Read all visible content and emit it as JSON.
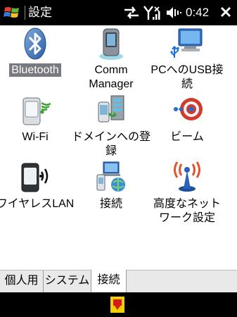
{
  "titlebar": {
    "title": "設定",
    "time": "0:42"
  },
  "icons": {
    "start": "windows-flag-icon",
    "connectivity": "connectivity-arrows-icon",
    "signal": "signal-strength-icon",
    "volume": "speaker-muted-icon",
    "close": "close-icon"
  },
  "items": [
    {
      "label": "Bluetooth",
      "icon": "bluetooth-icon",
      "selected": true
    },
    {
      "label1": "Comm",
      "label2": "Manager",
      "icon": "comm-manager-icon"
    },
    {
      "label1": "PCへのUSB接",
      "label2": "続",
      "icon": "usb-to-pc-icon"
    },
    {
      "label": "Wi-Fi",
      "icon": "wifi-icon"
    },
    {
      "label1": "ドメインへの登",
      "label2": "録",
      "icon": "domain-enroll-icon"
    },
    {
      "label": "ビーム",
      "icon": "beam-icon"
    },
    {
      "label": "ワイヤレスLAN",
      "icon": "wireless-lan-icon"
    },
    {
      "label": "接続",
      "icon": "connections-icon"
    },
    {
      "label1": "高度なネット",
      "label2": "ワーク設定",
      "icon": "advanced-network-icon"
    }
  ],
  "tabs": [
    {
      "label": "個人用",
      "active": false
    },
    {
      "label": "システム",
      "active": false
    },
    {
      "label": "接続",
      "active": true
    }
  ],
  "softkeys": {
    "input": "keyboard-input-icon"
  },
  "colors": {
    "bar": "#000000",
    "selection": "#777a80",
    "tab_bg": "#e9e9e9"
  }
}
